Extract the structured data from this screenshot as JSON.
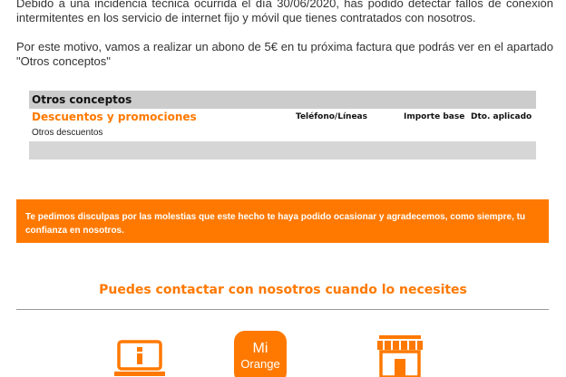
{
  "intro": {
    "paragraph1": "Debido a una incidencia técnica ocurrida el día 30/06/2020, has podido detectar fallos de conexión intermitentes en los servicio de internet fijo y móvil que tienes contratados con nosotros.",
    "paragraph2": "Por este motivo, vamos a realizar un abono de 5€ en tu próxima factura que podrás ver en el apartado \"Otros conceptos\""
  },
  "concepts": {
    "header": "Otros conceptos",
    "section_title": "Descuentos y promociones",
    "columns": [
      "Teléfono/Líneas",
      "Importe base",
      "Dto. aplicado"
    ],
    "rows": [
      {
        "label": "Otros descuentos"
      }
    ]
  },
  "banner": {
    "text": "Te pedimos disculpas por las molestias que este hecho te haya podido ocasionar y agradecemos, como siempre, tu confianza en nosotros."
  },
  "contact": {
    "title": "Puedes contactar con nosotros cuando lo necesites",
    "icons": [
      "info-laptop-icon",
      "mi-orange-app-icon",
      "store-icon"
    ],
    "mi_orange_top": "Mi",
    "mi_orange_bottom": "Orange"
  },
  "colors": {
    "brand_orange": "#ff7900",
    "table_gray": "#cccccc",
    "text": "#333333"
  }
}
